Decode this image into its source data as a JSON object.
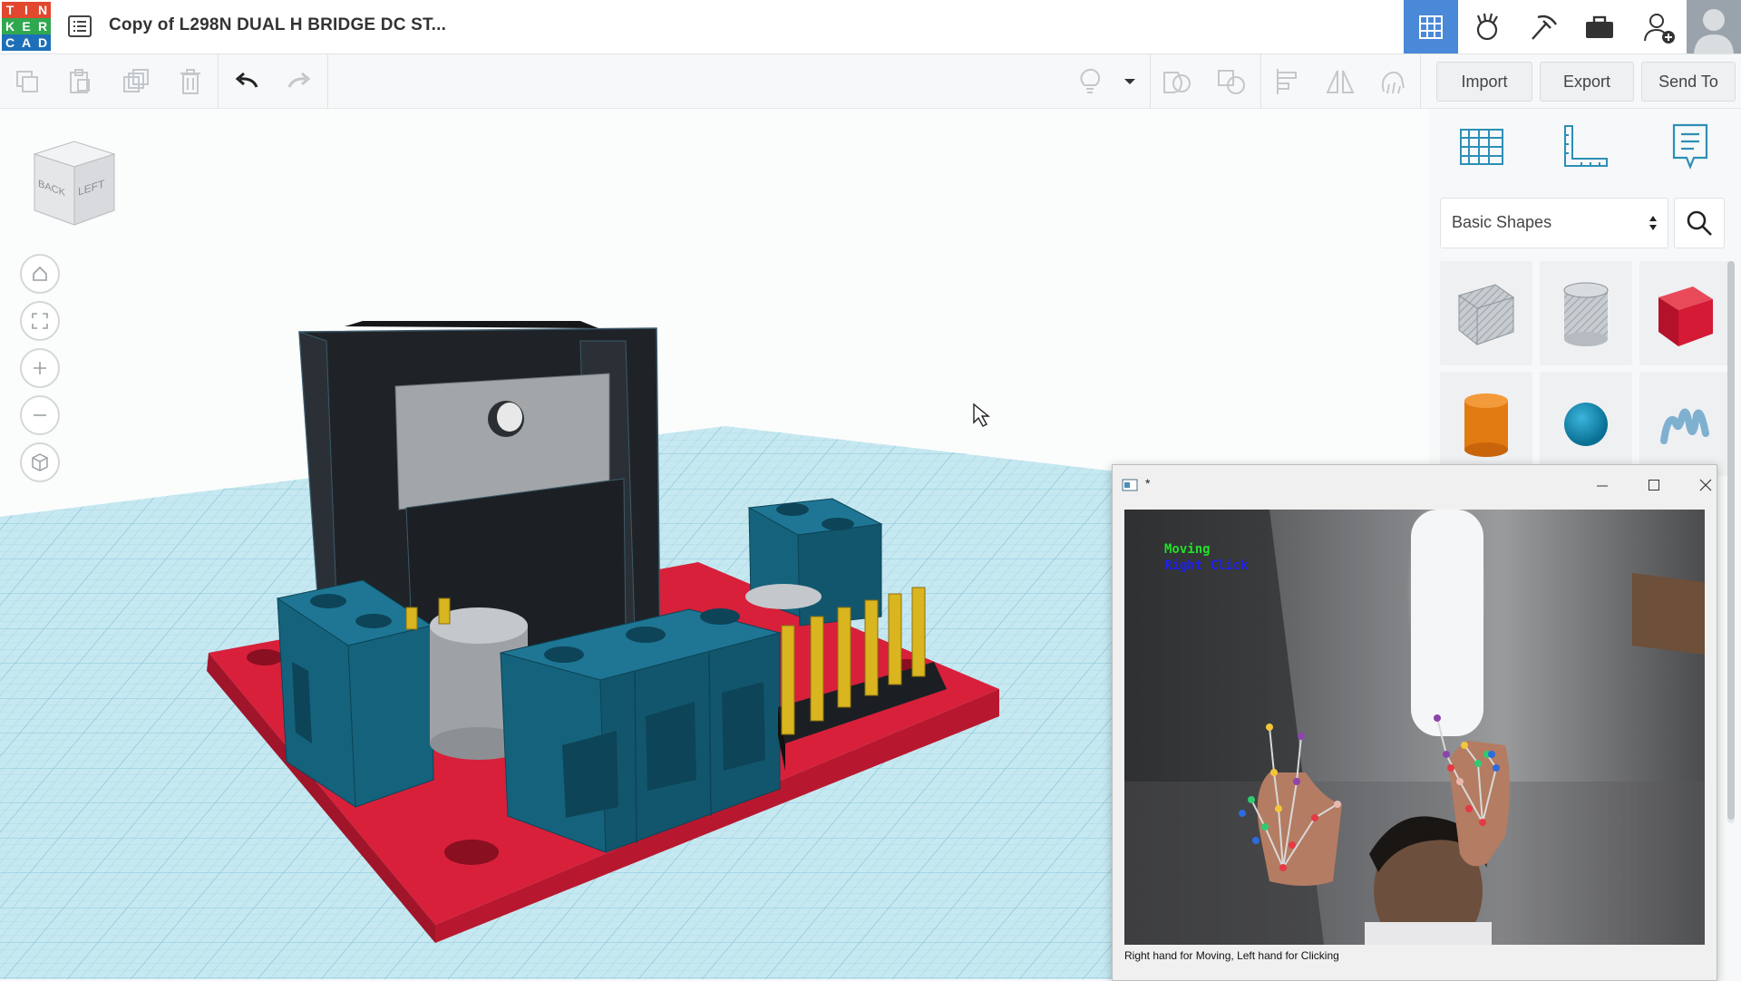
{
  "app": {
    "logo_letters": [
      "T",
      "I",
      "N",
      "K",
      "E",
      "R",
      "C",
      "A",
      "D"
    ],
    "logo_colors": [
      "#e2472f",
      "#e2472f",
      "#e2472f",
      "#2fa84f",
      "#2fa84f",
      "#2fa84f",
      "#1d6fb8",
      "#1d6fb8",
      "#1d6fb8"
    ],
    "document_title": "Copy of L298N DUAL H BRIDGE DC ST..."
  },
  "topbar": {
    "icons": [
      "grid-view-icon",
      "tinker-icon",
      "build-icon",
      "briefcase-icon",
      "add-user-icon",
      "avatar"
    ],
    "active_color": "#4a88d8"
  },
  "toolbar": {
    "import_label": "Import",
    "export_label": "Export",
    "send_to_label": "Send To"
  },
  "viewcube": {
    "back_label": "BACK",
    "left_label": "LEFT"
  },
  "panel": {
    "library_select": "Basic Shapes",
    "shapes": [
      "box",
      "cylinder-hole",
      "box-red",
      "cylinder-orange",
      "sphere-blue",
      "text-shape"
    ]
  },
  "camera_window": {
    "title": "*",
    "status_moving": "Moving",
    "status_click": "Right Click",
    "caption": "Right hand for Moving, Left hand for Clicking"
  },
  "colors": {
    "board_red": "#d8203a",
    "terminal_teal": "#15627c",
    "heatsink": "#1f2327",
    "pin_gold": "#d9b51f",
    "grid_blue": "#a9d8e6"
  }
}
